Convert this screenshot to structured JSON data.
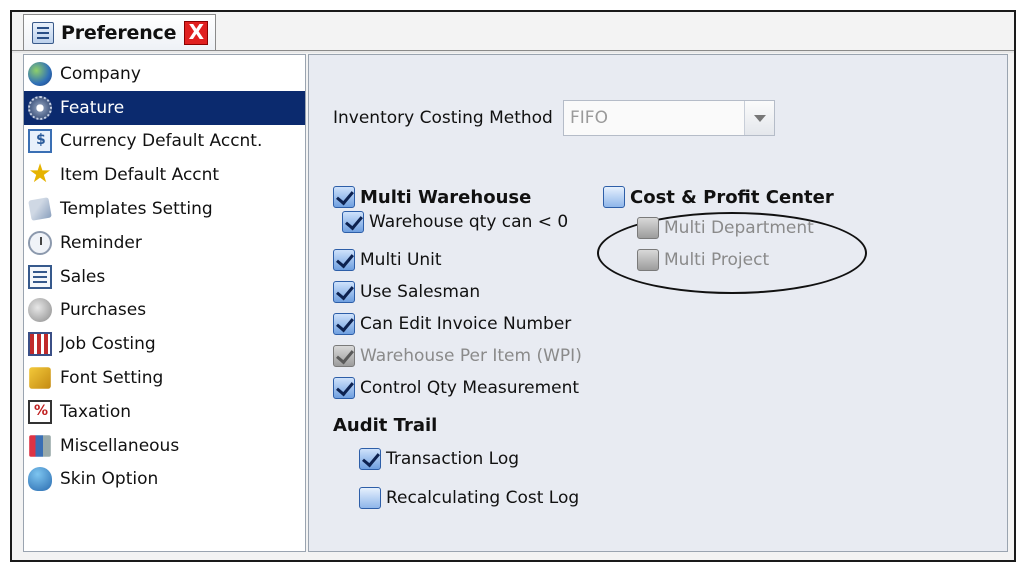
{
  "tab": {
    "title": "Preference",
    "close_label": "X"
  },
  "sidebar": {
    "items": [
      {
        "label": "Company",
        "icon": "globe-icon",
        "selected": false
      },
      {
        "label": "Feature",
        "icon": "gear-icon",
        "selected": true
      },
      {
        "label": "Currency Default Accnt.",
        "icon": "currency-icon",
        "selected": false
      },
      {
        "label": "Item Default Accnt",
        "icon": "star-icon",
        "selected": false
      },
      {
        "label": "Templates Setting",
        "icon": "templates-icon",
        "selected": false
      },
      {
        "label": "Reminder",
        "icon": "reminder-icon",
        "selected": false
      },
      {
        "label": "Sales",
        "icon": "sales-icon",
        "selected": false
      },
      {
        "label": "Purchases",
        "icon": "purchases-icon",
        "selected": false
      },
      {
        "label": "Job Costing",
        "icon": "job-costing-icon",
        "selected": false
      },
      {
        "label": "Font Setting",
        "icon": "font-icon",
        "selected": false
      },
      {
        "label": "Taxation",
        "icon": "taxation-icon",
        "selected": false
      },
      {
        "label": "Miscellaneous",
        "icon": "miscellaneous-icon",
        "selected": false
      },
      {
        "label": "Skin Option",
        "icon": "skin-icon",
        "selected": false
      }
    ]
  },
  "main": {
    "costing": {
      "label": "Inventory Costing Method",
      "value": "FIFO"
    },
    "options": {
      "multi_warehouse": {
        "label": "Multi Warehouse",
        "checked": true
      },
      "warehouse_qty": {
        "label": "Warehouse qty can < 0",
        "checked": true
      },
      "multi_unit": {
        "label": "Multi Unit",
        "checked": true
      },
      "use_salesman": {
        "label": "Use Salesman",
        "checked": true
      },
      "edit_invoice": {
        "label": "Can Edit Invoice Number",
        "checked": true
      },
      "wpi": {
        "label": "Warehouse Per Item (WPI)",
        "checked": true,
        "disabled": true
      },
      "control_qty": {
        "label": "Control Qty Measurement",
        "checked": true
      }
    },
    "cost_profit": {
      "label": "Cost & Profit Center",
      "checked": false,
      "multi_department": {
        "label": "Multi Department",
        "disabled": true
      },
      "multi_project": {
        "label": "Multi Project",
        "disabled": true
      }
    },
    "audit": {
      "title": "Audit Trail",
      "transaction_log": {
        "label": "Transaction Log",
        "checked": true
      },
      "recalc_log": {
        "label": "Recalculating Cost Log",
        "checked": false
      }
    }
  },
  "colors": {
    "selected_bg": "#0b2a6e",
    "panel_bg": "#e8ebf2",
    "close_red": "#e02020"
  }
}
